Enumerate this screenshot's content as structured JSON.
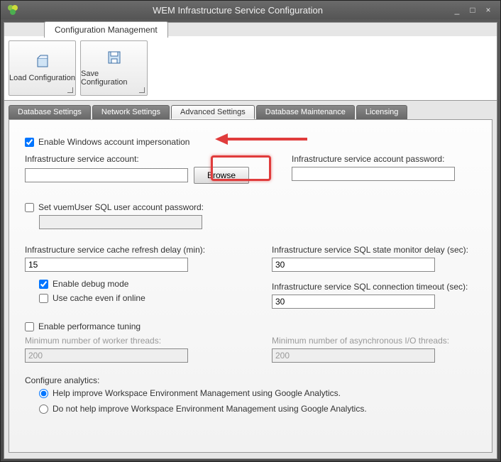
{
  "window": {
    "title": "WEM Infrastructure Service Configuration"
  },
  "ribbon": {
    "tab_label": "Configuration Management",
    "load_label": "Load Configuration",
    "save_label": "Save Configuration"
  },
  "tabs": {
    "db": "Database Settings",
    "net": "Network Settings",
    "adv": "Advanced Settings",
    "maint": "Database Maintenance",
    "lic": "Licensing"
  },
  "adv": {
    "enable_impersonation": "Enable Windows account impersonation",
    "infra_account_label": "Infrastructure service account:",
    "infra_account_value": "",
    "browse": "Browse",
    "infra_password_label": "Infrastructure service account password:",
    "infra_password_value": "",
    "set_vuem_label": "Set vuemUser SQL user account password:",
    "set_vuem_value": "",
    "cache_refresh_label": "Infrastructure service cache refresh delay (min):",
    "cache_refresh_value": "15",
    "debug_label": "Enable debug mode",
    "use_cache_label": "Use cache even if online",
    "sql_monitor_label": "Infrastructure service SQL state monitor delay (sec):",
    "sql_monitor_value": "30",
    "sql_timeout_label": "Infrastructure service SQL connection timeout (sec):",
    "sql_timeout_value": "30",
    "perf_label": "Enable performance tuning",
    "min_threads_label": "Minimum number of worker threads:",
    "min_threads_value": "200",
    "min_async_label": "Minimum number of asynchronous I/O threads:",
    "min_async_value": "200",
    "analytics_label": "Configure analytics:",
    "analytics_opt1": "Help improve Workspace Environment Management using Google Analytics.",
    "analytics_opt2": "Do not help improve Workspace Environment Management using Google Analytics."
  }
}
